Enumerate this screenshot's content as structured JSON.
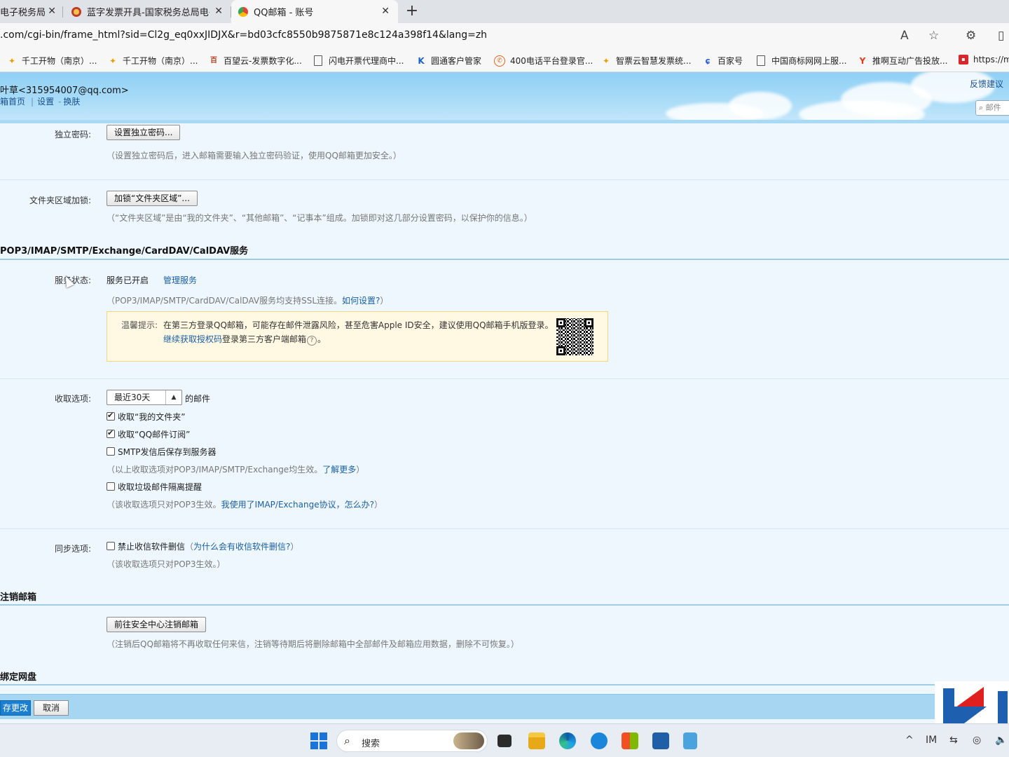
{
  "browser": {
    "tabs": [
      {
        "label": "电子税务局",
        "active": false
      },
      {
        "label": "蓝字发票开具-国家税务总局电子",
        "active": false
      },
      {
        "label": "QQ邮箱 - 账号",
        "active": true
      }
    ],
    "new_tab": "+",
    "close_glyph": "✕",
    "url": ".com/cgi-bin/frame_html?sid=Cl2g_eq0xxJIDJX&r=bd03cfc8550b9875871e8c124a398f14&lang=zh",
    "bookmarks": [
      {
        "label": "千工开物（南京）...",
        "icon": "star-bookmark-icon"
      },
      {
        "label": "千工开物（南京）...",
        "icon": "star-bookmark-icon"
      },
      {
        "label": "百望云-发票数字化...",
        "icon": "baiwang-icon"
      },
      {
        "label": "闪电开票代理商中...",
        "icon": "page-icon"
      },
      {
        "label": "圆通客户管家",
        "icon": "k-logo-icon"
      },
      {
        "label": "400电话平台登录官...",
        "icon": "phone-icon"
      },
      {
        "label": "智票云智慧发票统...",
        "icon": "star-bookmark-icon"
      },
      {
        "label": "百家号",
        "icon": "baijia-icon"
      },
      {
        "label": "中国商标网网上服...",
        "icon": "page-icon"
      },
      {
        "label": "推啊互动广告投放...",
        "icon": "tuia-icon"
      },
      {
        "label": "https://m",
        "icon": "news-icon"
      }
    ]
  },
  "mail_header": {
    "user": "叶草<315954007@qq.com>",
    "links": [
      "箱首页",
      "设置",
      "换肤"
    ],
    "link_sep": "|",
    "link_dash": "-",
    "feedback": "反馈建议",
    "search_placeholder": "邮件"
  },
  "settings": {
    "independent_password": {
      "label": "独立密码:",
      "button": "设置独立密码...",
      "hint": "（设置独立密码后，进入邮箱需要输入独立密码验证，使用QQ邮箱更加安全。）"
    },
    "folder_lock": {
      "label": "文件夹区域加锁:",
      "button": "加锁“文件夹区域”...",
      "hint": "（“文件夹区域”是由“我的文件夹”、“其他邮箱”、“记事本”组成。加锁即对这几部分设置密码，以保护你的信息。）"
    },
    "services_title": "POP3/IMAP/SMTP/Exchange/CardDAV/CalDAV服务",
    "service_status": {
      "label": "服务状态:",
      "value": "服务已开启",
      "manage_link": "管理服务",
      "ssl_hint_prefix": "（POP3/IMAP/SMTP/CardDAV/CalDAV服务均支持SSL连接。",
      "ssl_hint_link": "如何设置?",
      "ssl_hint_suffix": "）"
    },
    "warning": {
      "prefix": "温馨提示:",
      "text": "在第三方登录QQ邮箱，可能存在邮件泄露风险，甚至危害Apple ID安全，建议使用QQ邮箱手机版登录。",
      "link": "继续获取授权码",
      "text2": "登录第三方客户端邮箱",
      "help": "?",
      "end": "。"
    },
    "receive": {
      "label": "收取选项:",
      "select_value": "最近30天",
      "select_suffix": "的邮件",
      "options": [
        {
          "label": "收取“我的文件夹”",
          "checked": true
        },
        {
          "label": "收取“QQ邮件订阅”",
          "checked": true
        },
        {
          "label": "SMTP发信后保存到服务器",
          "checked": false
        }
      ],
      "hint1_prefix": "（以上收取选项对POP3/IMAP/SMTP/Exchange均生效。",
      "hint1_link": "了解更多",
      "hint1_suffix": "）",
      "spam_option": {
        "label": "收取垃圾邮件隔离提醒",
        "checked": false
      },
      "hint2_prefix": "（该收取选项只对POP3生效。",
      "hint2_link": "我使用了IMAP/Exchange协议，怎么办?",
      "hint2_suffix": "）"
    },
    "sync": {
      "label": "同步选项:",
      "option": {
        "label": "禁止收信软件删信",
        "checked": false
      },
      "why_prefix": "（",
      "why_link": "为什么会有收信软件删信?",
      "why_suffix": "）",
      "hint": "（该收取选项只对POP3生效。）"
    },
    "cancel_account": {
      "title": "注销邮箱",
      "button": "前往安全中心注销邮箱",
      "hint": "（注销后QQ邮箱将不再收取任何来信，注销等待期后将删除邮箱中全部邮件及邮箱应用数据，删除不可恢复。）"
    },
    "bind_disk_title": "绑定网盘"
  },
  "footer": {
    "save": "存更改",
    "cancel": "取消"
  },
  "taskbar": {
    "search_text": "搜索",
    "apps": [
      "file-explorer-icon",
      "edge-icon",
      "onedrive-icon",
      "store-icon",
      "mail-app-icon",
      "notepad-icon"
    ]
  },
  "colors": {
    "link": "#1a5fa3",
    "header_sky": "#a9dcf8",
    "save_button": "#1b7fd0",
    "warning_bg": "#fff8e2"
  }
}
